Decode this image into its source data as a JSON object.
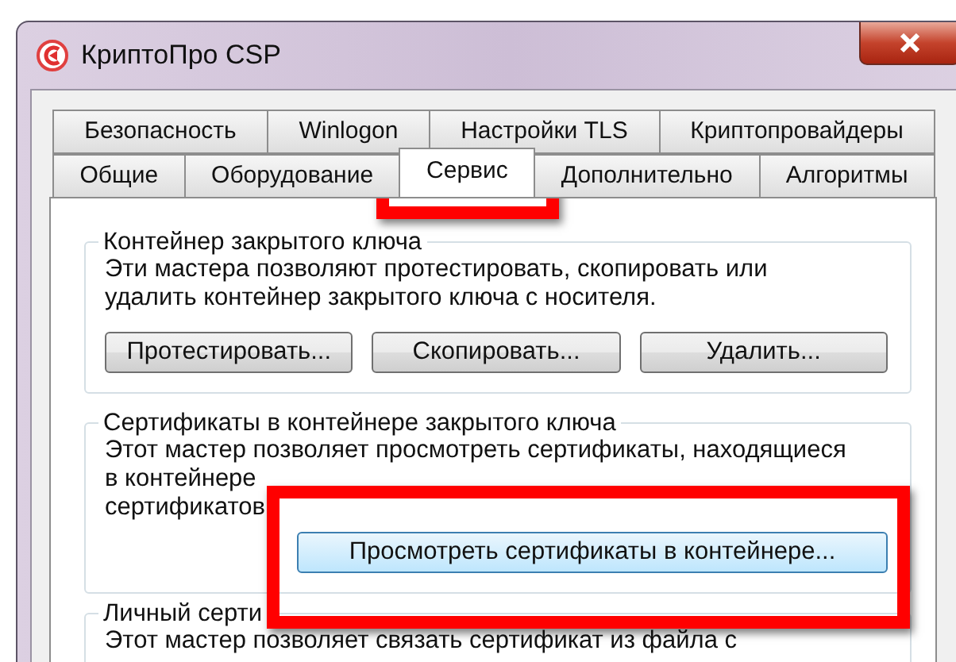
{
  "window": {
    "title": "КриптоПро CSP"
  },
  "tab_rows": [
    [
      {
        "label": "Безопасность",
        "selected": false
      },
      {
        "label": "Winlogon",
        "selected": false
      },
      {
        "label": "Настройки TLS",
        "selected": false
      },
      {
        "label": "Криптопровайдеры",
        "selected": false
      }
    ],
    [
      {
        "label": "Общие",
        "selected": false
      },
      {
        "label": "Оборудование",
        "selected": false
      },
      {
        "label": "Сервис",
        "selected": true
      },
      {
        "label": "Дополнительно",
        "selected": false
      },
      {
        "label": "Алгоритмы",
        "selected": false
      }
    ]
  ],
  "groups": [
    {
      "title": "Контейнер закрытого ключа",
      "description_lines": [
        "Эти мастера позволяют протестировать, скопировать или",
        "удалить контейнер закрытого ключа с носителя."
      ],
      "buttons": [
        {
          "label": "Протестировать...",
          "default": false
        },
        {
          "label": "Скопировать...",
          "default": false
        },
        {
          "label": "Удалить...",
          "default": false
        }
      ]
    },
    {
      "title": "Сертификаты в контейнере закрытого ключа",
      "description_lines": [
        "Этот мастер позволяет просмотреть сертификаты, находящиеся",
        "в контейнере",
        "сертификатов"
      ],
      "buttons": [
        {
          "label": "Просмотреть сертификаты в контейнере...",
          "default": true
        }
      ]
    },
    {
      "title": "Личный серти",
      "description_lines": [
        "Этот мастер позволяет связать сертификат из файла с"
      ]
    }
  ]
}
